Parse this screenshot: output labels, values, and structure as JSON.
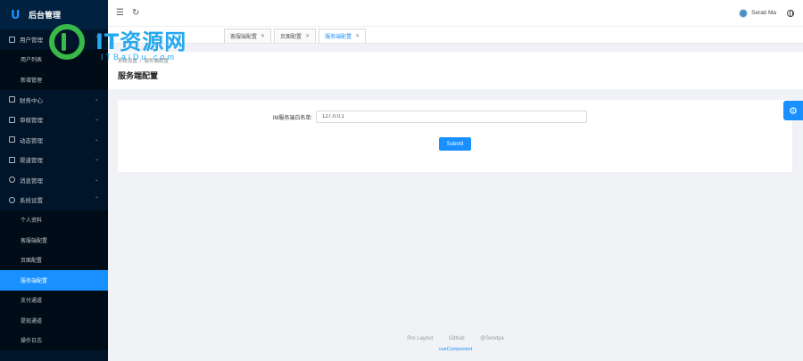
{
  "brand": {
    "title": "后台管理"
  },
  "sidebar": {
    "groups": [
      {
        "label": "用户管理",
        "expanded": true,
        "children": [
          "用户列表",
          "新增管理"
        ]
      },
      {
        "label": "财务中心"
      },
      {
        "label": "审核管理"
      },
      {
        "label": "动态管理"
      },
      {
        "label": "渠道管理"
      },
      {
        "label": "消息管理"
      },
      {
        "label": "系统设置",
        "expanded": true,
        "children": [
          "个人资料",
          "客服端配置",
          "页面配置",
          "服务端配置",
          "支付通道",
          "提现通道",
          "操作日志"
        ]
      }
    ],
    "active_item": "服务端配置"
  },
  "header": {
    "collapse_icon": "menu-fold-icon",
    "refresh_icon": "reload-icon",
    "user_name": "Serati Ma",
    "lang_icon": "global-icon"
  },
  "tabs": [
    {
      "label": "客服端配置"
    },
    {
      "label": "页面配置"
    },
    {
      "label": "服务端配置",
      "active": true
    }
  ],
  "page": {
    "breadcrumb": [
      "系统设置",
      "服务端配置"
    ],
    "title": "服务端配置"
  },
  "form": {
    "label": "IM服务端白名单:",
    "value": "127.0.0.1",
    "submit_label": "Submit"
  },
  "footer": {
    "links": [
      "Pro Layout",
      "Github",
      "@Sendya"
    ],
    "brand": "vueComponent"
  },
  "watermark": {
    "text": "IT资源网",
    "sub": "ITBaiDu.com"
  },
  "colors": {
    "primary": "#1890ff",
    "sidebar_bg": "#001529",
    "submenu_bg": "#000c17"
  }
}
